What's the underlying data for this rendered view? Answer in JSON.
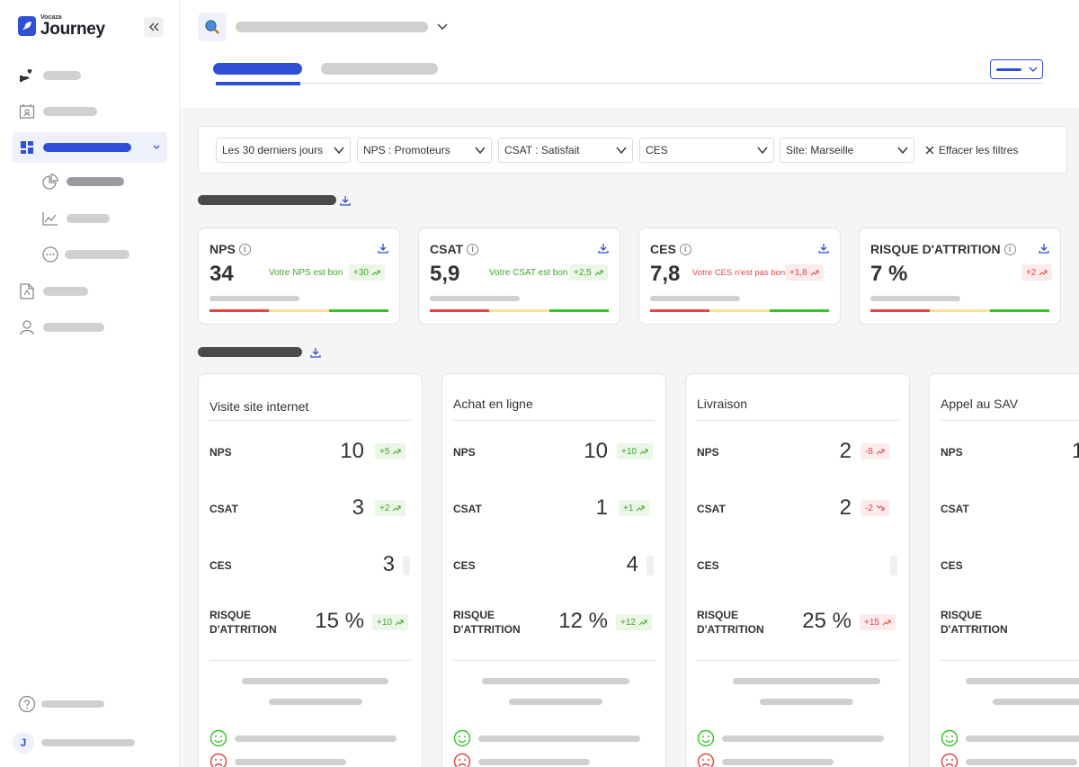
{
  "logo": {
    "small": "Vocaza",
    "big": "Journey"
  },
  "sidebar": {
    "user_initial": "J"
  },
  "filters": [
    {
      "value": "Les 30 derniers jours"
    },
    {
      "value": "NPS : Promoteurs"
    },
    {
      "value": "CSAT : Satisfait"
    },
    {
      "value": "CES"
    },
    {
      "value": "Site: Marseille"
    }
  ],
  "clear_filters": "Effacer les filtres",
  "kpis": [
    {
      "title": "NPS",
      "value": "34",
      "message": "Votre NPS est bon",
      "trend": "+30",
      "tone": "green"
    },
    {
      "title": "CSAT",
      "value": "5,9",
      "message": "Votre CSAT est bon",
      "trend": "+2,5",
      "tone": "green"
    },
    {
      "title": "CES",
      "value": "7,8",
      "message": "Votre CES n'est pas bon",
      "trend": "+1,8",
      "tone": "red"
    },
    {
      "title": "RISQUE D'ATTRITION",
      "value": "7 %",
      "message": "",
      "trend": "+2",
      "tone": "red"
    }
  ],
  "touchpoints": [
    {
      "title": "Visite site internet",
      "metrics": [
        {
          "label": "NPS",
          "value": "10",
          "trend": "+5",
          "tone": "green",
          "dir": "up"
        },
        {
          "label": "CSAT",
          "value": "3",
          "trend": "+2",
          "tone": "green",
          "dir": "up"
        },
        {
          "label": "CES",
          "value": "3",
          "trend": "",
          "tone": "grey",
          "dir": ""
        },
        {
          "label": "RISQUE D'ATTRITION",
          "value": "15 %",
          "trend": "+10",
          "tone": "green",
          "dir": "up"
        }
      ]
    },
    {
      "title": "Achat en ligne",
      "metrics": [
        {
          "label": "NPS",
          "value": "10",
          "trend": "+10",
          "tone": "green",
          "dir": "up"
        },
        {
          "label": "CSAT",
          "value": "1",
          "trend": "+1",
          "tone": "green",
          "dir": "up"
        },
        {
          "label": "CES",
          "value": "4",
          "trend": "",
          "tone": "grey",
          "dir": ""
        },
        {
          "label": "RISQUE D'ATTRITION",
          "value": "12 %",
          "trend": "+12",
          "tone": "green",
          "dir": "up"
        }
      ]
    },
    {
      "title": "Livraison",
      "metrics": [
        {
          "label": "NPS",
          "value": "2",
          "trend": "-8",
          "tone": "red",
          "dir": "up"
        },
        {
          "label": "CSAT",
          "value": "2",
          "trend": "-2",
          "tone": "red",
          "dir": "down"
        },
        {
          "label": "CES",
          "value": "",
          "trend": "",
          "tone": "grey",
          "dir": ""
        },
        {
          "label": "RISQUE D'ATTRITION",
          "value": "25 %",
          "trend": "+15",
          "tone": "red",
          "dir": "up"
        }
      ]
    },
    {
      "title": "Appel au SAV",
      "metrics": [
        {
          "label": "NPS",
          "value": "1",
          "trend": "",
          "tone": "",
          "dir": ""
        },
        {
          "label": "CSAT",
          "value": "",
          "trend": "",
          "tone": "",
          "dir": ""
        },
        {
          "label": "CES",
          "value": "",
          "trend": "",
          "tone": "",
          "dir": ""
        },
        {
          "label": "RISQUE D'ATTRITION",
          "value": "",
          "trend": "",
          "tone": "",
          "dir": ""
        }
      ]
    }
  ],
  "colors": {
    "accent": "#2f4fd8",
    "good": "#3ea52b",
    "bad": "#e14848"
  }
}
